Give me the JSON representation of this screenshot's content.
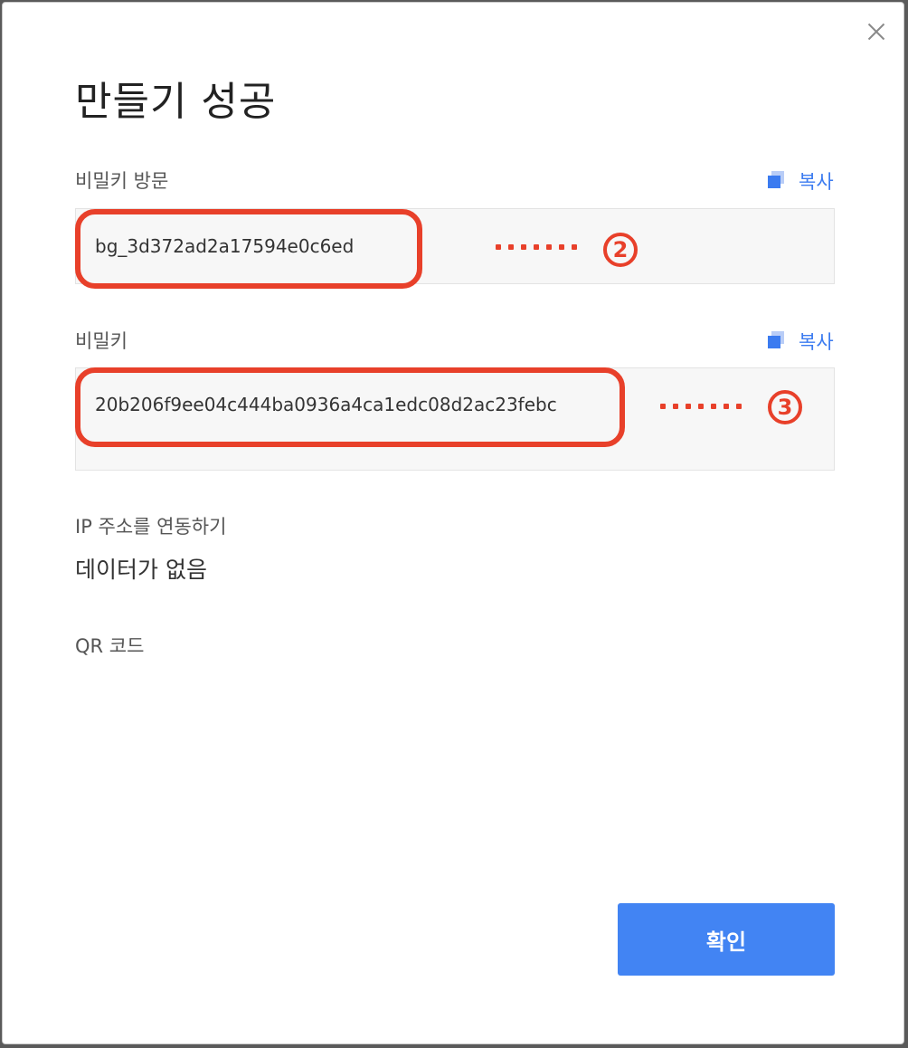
{
  "dialog": {
    "title": "만들기 성공",
    "close_icon": "close-icon"
  },
  "access_key": {
    "label": "비밀키 방문",
    "copy_label": "복사",
    "value": "bg_3d372ad2a17594e0c6ed",
    "annotation": "2"
  },
  "secret_key": {
    "label": "비밀키",
    "copy_label": "복사",
    "value": "20b206f9ee04c444ba0936a4ca1edc08d2ac23febc",
    "annotation": "3"
  },
  "ip_binding": {
    "label": "IP 주소를 연동하기",
    "value": "데이터가 없음"
  },
  "qr_code": {
    "label": "QR 코드"
  },
  "footer": {
    "confirm_label": "확인"
  },
  "colors": {
    "accent": "#4284f3",
    "highlight": "#e8402a",
    "copy_link": "#3b7bf0"
  }
}
